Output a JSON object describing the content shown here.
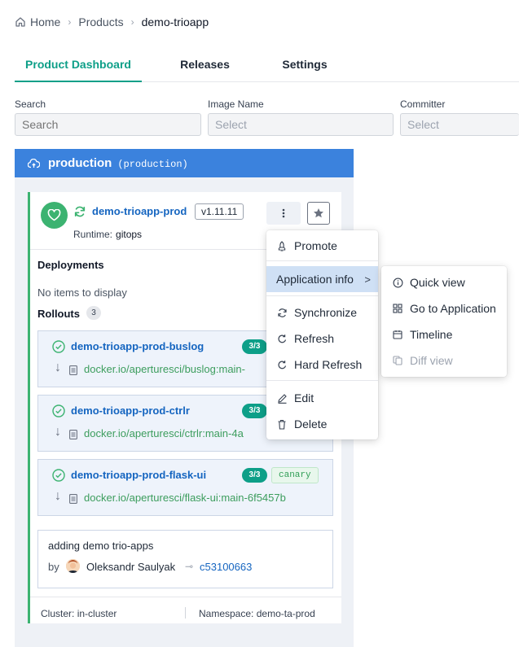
{
  "breadcrumb": {
    "home": "Home",
    "products": "Products",
    "current": "demo-trioapp"
  },
  "tabs": [
    {
      "label": "Product Dashboard"
    },
    {
      "label": "Releases"
    },
    {
      "label": "Settings"
    }
  ],
  "filters": {
    "search": {
      "label": "Search",
      "placeholder": "Search"
    },
    "image": {
      "label": "Image Name",
      "value": "Select"
    },
    "committer": {
      "label": "Committer",
      "value": "Select"
    }
  },
  "environment": {
    "name": "production",
    "sub": "(production)",
    "color": "#3b82dd"
  },
  "app": {
    "name": "demo-trioapp-prod",
    "version": "v1.11.11",
    "runtime_label": "Runtime:",
    "runtime": "gitops",
    "health_icon": "heart-icon",
    "sync_icon": "sync-icon"
  },
  "deployments": {
    "title": "Deployments",
    "empty": "No items to display"
  },
  "rollouts": {
    "title": "Rollouts",
    "count": "3",
    "items": [
      {
        "name": "demo-trioapp-prod-buslog",
        "ratio": "3/3",
        "image": "docker.io/aperturesci/buslog:main-",
        "tag": ""
      },
      {
        "name": "demo-trioapp-prod-ctrlr",
        "ratio": "3/3",
        "image": "docker.io/aperturesci/ctrlr:main-4a",
        "tag": ""
      },
      {
        "name": "demo-trioapp-prod-flask-ui",
        "ratio": "3/3",
        "image": "docker.io/aperturesci/flask-ui:main-6f5457b",
        "tag": "canary"
      }
    ]
  },
  "commit": {
    "message": "adding demo trio-apps",
    "by": "by",
    "author": "Oleksandr Saulyak",
    "sha": "c53100663"
  },
  "footer": {
    "cluster_label": "Cluster:",
    "cluster": "in-cluster",
    "namespace_label": "Namespace:",
    "namespace": "demo-ta-prod"
  },
  "menu": {
    "items": [
      {
        "label": "Promote",
        "icon": "rocket-icon"
      },
      {
        "label": "Application info",
        "icon": "",
        "submenu_indicator": ">"
      },
      {
        "label": "Synchronize",
        "icon": "sync-icon"
      },
      {
        "label": "Refresh",
        "icon": "refresh-icon"
      },
      {
        "label": "Hard Refresh",
        "icon": "hard-refresh-icon"
      },
      {
        "label": "Edit",
        "icon": "pencil-icon"
      },
      {
        "label": "Delete",
        "icon": "trash-icon"
      }
    ]
  },
  "submenu": {
    "items": [
      {
        "label": "Quick view",
        "icon": "info-icon",
        "disabled": false
      },
      {
        "label": "Go to Application",
        "icon": "grid-icon",
        "disabled": false
      },
      {
        "label": "Timeline",
        "icon": "calendar-icon",
        "disabled": false
      },
      {
        "label": "Diff view",
        "icon": "diff-icon",
        "disabled": true
      }
    ]
  },
  "colors": {
    "accent": "#0d9f88",
    "link": "#1565c0",
    "healthy": "#3cb371",
    "menu_highlight": "#cfe0f5"
  }
}
